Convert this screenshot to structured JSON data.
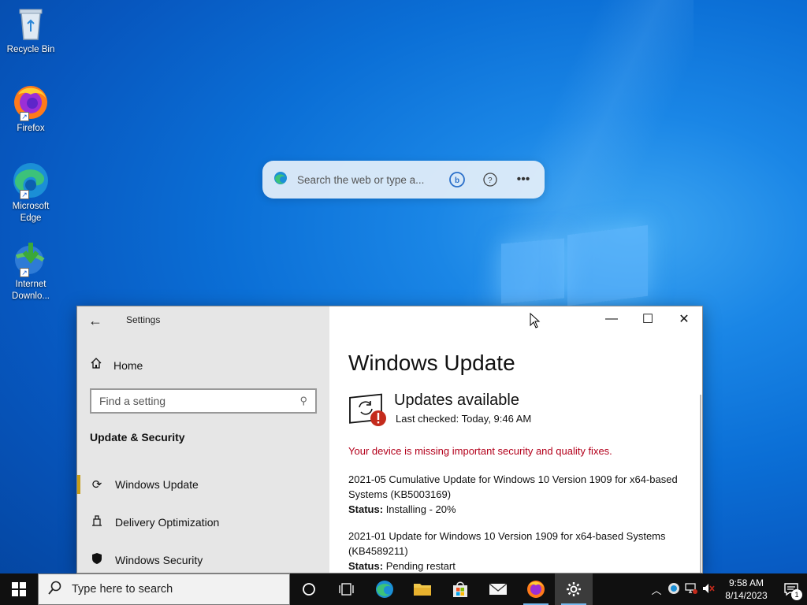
{
  "desktop": {
    "icons": [
      {
        "label": "Recycle Bin",
        "icon": "recycle-bin-icon"
      },
      {
        "label": "Firefox",
        "icon": "firefox-icon"
      },
      {
        "label": "Microsoft Edge",
        "icon": "edge-icon"
      },
      {
        "label": "Internet Downlo...",
        "icon": "idm-icon"
      }
    ],
    "search_widget": {
      "placeholder": "Search the web or type a...",
      "icons": [
        "edge-logo-icon",
        "bing-chat-icon",
        "help-icon",
        "more-icon"
      ]
    }
  },
  "settings": {
    "title": "Settings",
    "home_label": "Home",
    "find_placeholder": "Find a setting",
    "section_header": "Update & Security",
    "nav_items": [
      {
        "label": "Windows Update",
        "icon": "refresh-icon",
        "active": true
      },
      {
        "label": "Delivery Optimization",
        "icon": "delivery-icon",
        "active": false
      },
      {
        "label": "Windows Security",
        "icon": "shield-icon",
        "active": false
      }
    ],
    "page_title": "Windows Update",
    "status_heading": "Updates available",
    "last_checked": "Last checked: Today, 9:46 AM",
    "warning": "Your device is missing important security and quality fixes.",
    "updates": [
      {
        "name": "2021-05 Cumulative Update for Windows 10 Version 1909 for x64-based Systems (KB5003169)",
        "status_label": "Status:",
        "status_value": "Installing - 20%"
      },
      {
        "name": "2021-01 Update for Windows 10 Version 1909 for x64-based Systems (KB4589211)",
        "status_label": "Status:",
        "status_value": "Pending restart"
      }
    ],
    "accent_color": "#c59d1a",
    "warning_color": "#b3001b"
  },
  "taskbar": {
    "search_placeholder": "Type here to search",
    "apps": [
      "cortana-icon",
      "task-view-icon",
      "edge-icon",
      "file-explorer-icon",
      "store-icon",
      "mail-icon",
      "firefox-icon",
      "settings-gear-icon"
    ],
    "time": "9:58 AM",
    "date": "8/14/2023",
    "notification_count": "1"
  }
}
